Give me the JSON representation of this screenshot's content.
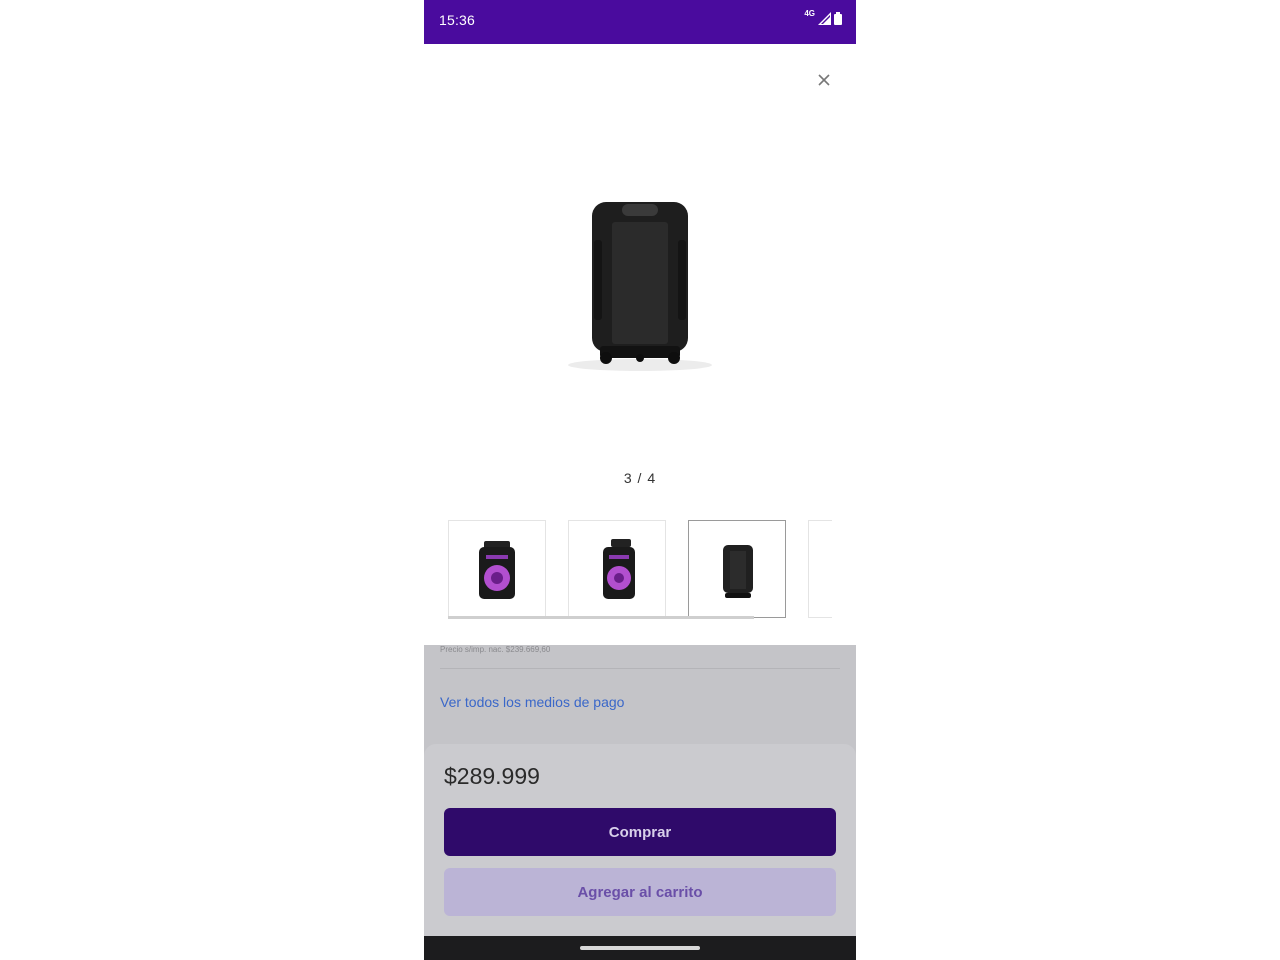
{
  "status_bar": {
    "time": "15:36",
    "network": "4G",
    "signal_icon": "signal-icon",
    "battery_icon": "battery-icon"
  },
  "gallery": {
    "close_icon": "close-icon",
    "counter": "3 / 4",
    "thumbnails": [
      {
        "name": "speaker-front-purple",
        "selected": false
      },
      {
        "name": "speaker-angle-purple",
        "selected": false
      },
      {
        "name": "speaker-back-black",
        "selected": true
      },
      {
        "name": "speaker-side",
        "selected": false
      }
    ]
  },
  "product": {
    "tax_line": "Precio s/imp. nac. $239.669,60",
    "payment_methods_link": "Ver todos los medios de pago",
    "price": "$289.999",
    "buy_label": "Comprar",
    "add_to_cart_label": "Agregar al carrito"
  },
  "colors": {
    "status_bar": "#4a0b9e",
    "primary_button": "#2f0a6a",
    "link": "#3a67c9"
  }
}
